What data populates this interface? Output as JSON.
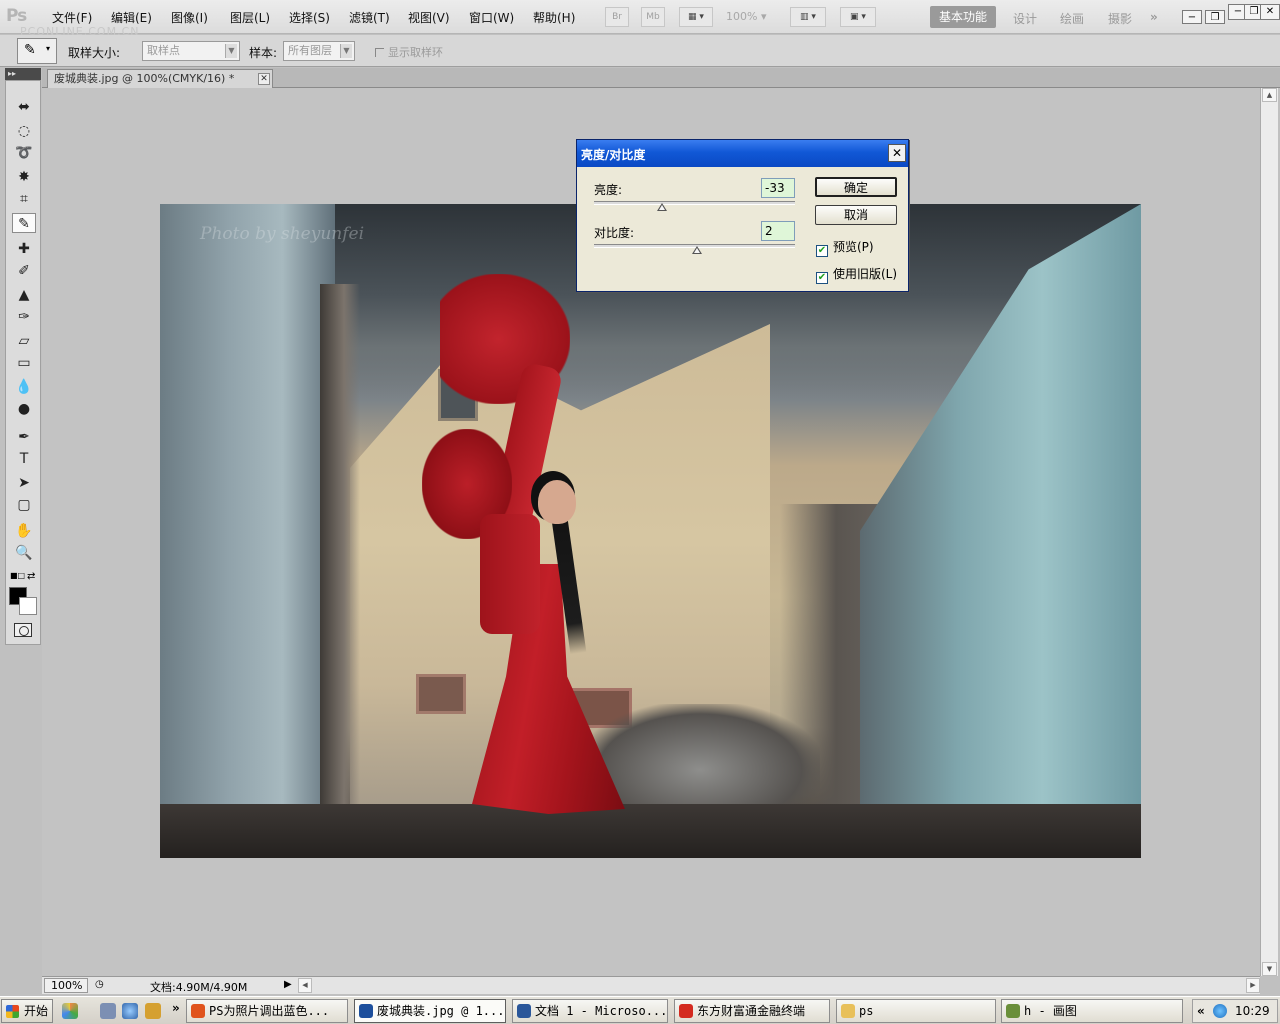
{
  "app": {
    "logo": "Ps",
    "watermark": "PCONLINE.COM.CN",
    "menu": [
      "文件(F)",
      "编辑(E)",
      "图像(I)",
      "图层(L)",
      "选择(S)",
      "滤镜(T)",
      "视图(V)",
      "窗口(W)",
      "帮助(H)"
    ],
    "quick_buttons": [
      "Br",
      "Mb"
    ],
    "zoom_dropdown": "100%",
    "workspaces": {
      "active": "基本功能",
      "others": [
        "设计",
        "绘画",
        "摄影"
      ],
      "more": "»"
    },
    "window_buttons": [
      "−",
      "❐",
      "✕"
    ]
  },
  "options_bar": {
    "sample_size_label": "取样大小:",
    "sample_size_value": "取样点",
    "sample_label": "样本:",
    "sample_value": "所有图层",
    "show_ring_label": "显示取样环"
  },
  "toolbox": {
    "tools": [
      {
        "name": "move-tool-icon",
        "glyph": "⬌"
      },
      {
        "name": "marquee-tool-icon",
        "glyph": "◌"
      },
      {
        "name": "lasso-tool-icon",
        "glyph": "➰"
      },
      {
        "name": "magic-wand-tool-icon",
        "glyph": "✸"
      },
      {
        "name": "crop-tool-icon",
        "glyph": "⌗"
      },
      {
        "name": "eyedropper-tool-icon",
        "glyph": "✎"
      },
      {
        "name": "healing-brush-tool-icon",
        "glyph": "✚"
      },
      {
        "name": "brush-tool-icon",
        "glyph": "✐"
      },
      {
        "name": "stamp-tool-icon",
        "glyph": "▲"
      },
      {
        "name": "history-brush-tool-icon",
        "glyph": "✑"
      },
      {
        "name": "eraser-tool-icon",
        "glyph": "▱"
      },
      {
        "name": "gradient-tool-icon",
        "glyph": "▭"
      },
      {
        "name": "blur-tool-icon",
        "glyph": "💧"
      },
      {
        "name": "dodge-tool-icon",
        "glyph": "●"
      },
      {
        "name": "pen-tool-icon",
        "glyph": "✒"
      },
      {
        "name": "type-tool-icon",
        "glyph": "T"
      },
      {
        "name": "path-select-tool-icon",
        "glyph": "➤"
      },
      {
        "name": "shape-tool-icon",
        "glyph": "▢"
      },
      {
        "name": "hand-tool-icon",
        "glyph": "✋"
      },
      {
        "name": "zoom-tool-icon",
        "glyph": "🔍"
      }
    ],
    "active_tool_index": 5,
    "foreground_color": "#000000",
    "background_color": "#ffffff"
  },
  "document": {
    "tab_title": "废城典装.jpg @ 100%(CMYK/16) *",
    "photo_credit": "Photo by sheyunfei",
    "zoom": "100%",
    "doc_size": "文档:4.90M/4.90M"
  },
  "dialog": {
    "title": "亮度/对比度",
    "brightness_label": "亮度:",
    "brightness_value": "-33",
    "brightness_slider_fraction": 0.34,
    "contrast_label": "对比度:",
    "contrast_value": "2",
    "contrast_slider_fraction": 0.51,
    "ok_label": "确定",
    "cancel_label": "取消",
    "preview_label": "预览(P)",
    "preview_checked": true,
    "legacy_label": "使用旧版(L)",
    "legacy_checked": true
  },
  "taskbar": {
    "start_label": "开始",
    "more": "»",
    "tasks": [
      {
        "label": "PS为照片调出蓝色...",
        "color": "#e0531c",
        "active": false
      },
      {
        "label": "废城典装.jpg @ 1...",
        "color": "#1d4f9c",
        "active": true
      },
      {
        "label": "文档 1 - Microso...",
        "color": "#2b579a",
        "active": false
      },
      {
        "label": "东方财富通金融终端",
        "color": "#d42a1f",
        "active": false
      },
      {
        "label": "ps",
        "color": "#e8c05a",
        "active": false
      },
      {
        "label": "h - 画图",
        "color": "#6a8f3a",
        "active": false
      }
    ],
    "tray_chevron": "«",
    "clock": "10:29"
  }
}
